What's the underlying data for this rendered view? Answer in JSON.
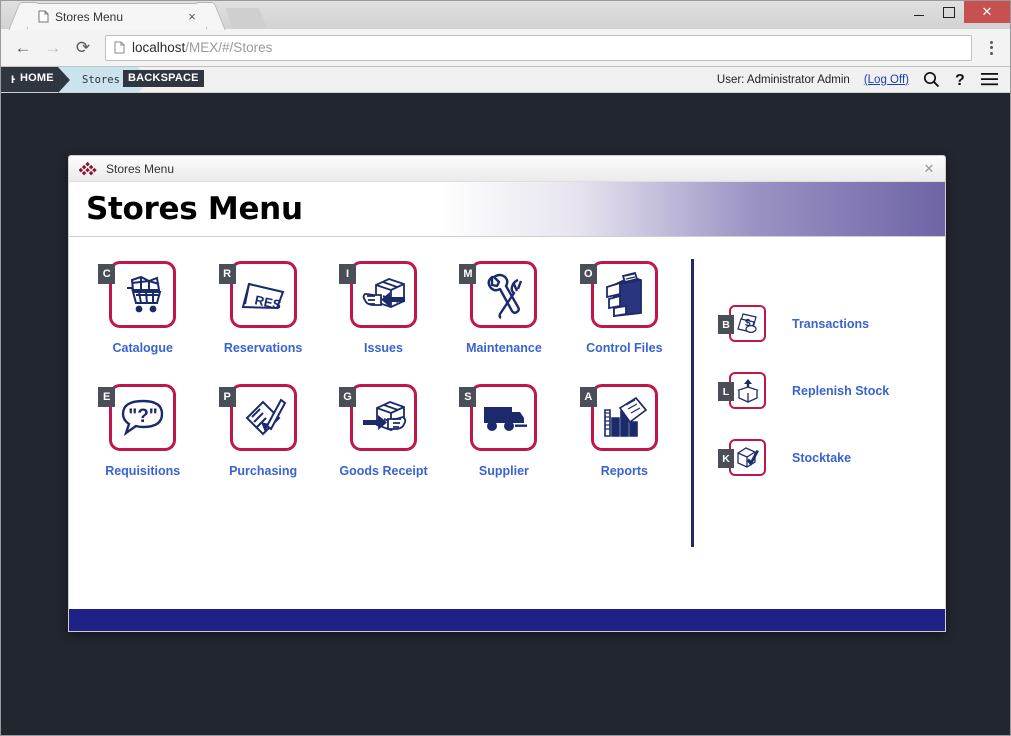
{
  "browser": {
    "tab": {
      "title": "Stores Menu",
      "favicon_icon": "page-icon",
      "close_icon": "×"
    },
    "newtab_label": "",
    "window_controls": {
      "minimize": "–",
      "maximize": "□",
      "close": "✕"
    },
    "toolbar": {
      "back_icon": "←",
      "forward_icon": "→",
      "reload_icon": "⟳",
      "page_info_icon": "page-icon",
      "url_host": "localhost",
      "url_path": "/MEX/#/Stores",
      "menu_icon": "kebab-icon"
    }
  },
  "appbar": {
    "home_label": "HOME",
    "current_label": "Stores",
    "shortcut_home": "HOME",
    "shortcut_back": "BACKSPACE",
    "user_text": "User: Administrator Admin",
    "logoff_label": "(Log Off)",
    "search_icon": "search-icon",
    "help_icon": "help-icon",
    "menu_icon": "hamburger-icon"
  },
  "dialog": {
    "titlebar_title": "Stores Menu",
    "close_icon": "✕",
    "header_title": "Stores Menu",
    "tiles": [
      {
        "key": "C",
        "label": "Catalogue",
        "icon": "shopping-cart-icon"
      },
      {
        "key": "R",
        "label": "Reservations",
        "icon": "reservation-sign-icon"
      },
      {
        "key": "I",
        "label": "Issues",
        "icon": "box-hand-out-icon"
      },
      {
        "key": "M",
        "label": "Maintenance",
        "icon": "wrench-tools-icon"
      },
      {
        "key": "O",
        "label": "Control Files",
        "icon": "filing-cabinet-icon"
      },
      {
        "key": "E",
        "label": "Requisitions",
        "icon": "question-speech-bubble-icon"
      },
      {
        "key": "P",
        "label": "Purchasing",
        "icon": "clipboard-pen-icon"
      },
      {
        "key": "G",
        "label": "Goods Receipt",
        "icon": "box-arrow-in-icon"
      },
      {
        "key": "S",
        "label": "Supplier",
        "icon": "truck-icon"
      },
      {
        "key": "A",
        "label": "Reports",
        "icon": "chart-documents-icon"
      }
    ],
    "side_items": [
      {
        "key": "B",
        "label": "Transactions",
        "icon": "money-documents-icon"
      },
      {
        "key": "L",
        "label": "Replenish Stock",
        "icon": "box-arrow-up-icon"
      },
      {
        "key": "K",
        "label": "Stocktake",
        "icon": "box-check-icon"
      }
    ]
  },
  "colors": {
    "tile_border": "#c0174a",
    "label_blue": "#3a63cf",
    "icon_navy": "#1b2a6b",
    "footer_blue": "#1e2287",
    "desktop": "#22262e",
    "badge_grey": "#4a4f57"
  }
}
